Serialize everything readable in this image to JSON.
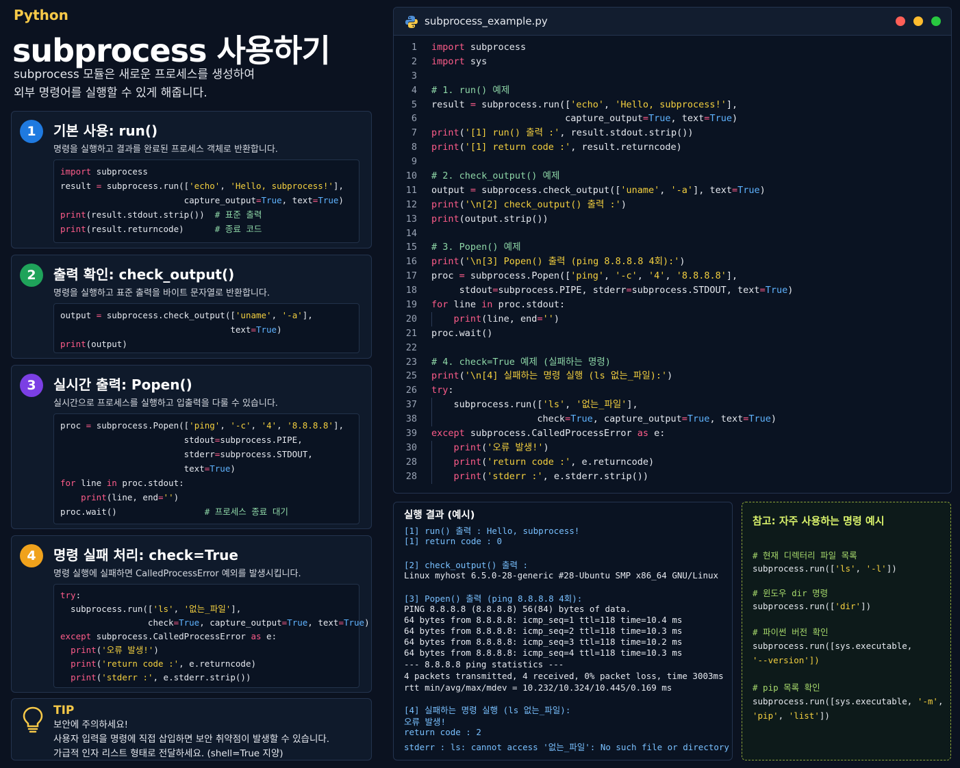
{
  "header": {
    "lang": "Python",
    "title": "subprocess 사용하기",
    "intro": [
      "subprocess 모듈은 새로운 프로세스를 생성하여",
      "외부 명령어를 실행할 수 있게 해줍니다."
    ]
  },
  "colors": {
    "accent": "#f7c948",
    "keyword": "#ff5c8a",
    "string": "#f4d03f",
    "builtin": "#5fb3ff",
    "comment": "#8fd8a8"
  },
  "cards": [
    {
      "num": "1",
      "title": "기본 사용: run()",
      "desc": "명령을 실행하고 결과를 완료된 프로세스 객체로 반환합니다."
    },
    {
      "num": "2",
      "title": "출력 확인: check_output()",
      "desc": "명령을 실행하고 표준 출력을 바이트 문자열로 반환합니다."
    },
    {
      "num": "3",
      "title": "실시간 출력: Popen()",
      "desc": "실시간으로 프로세스를 실행하고 입출력을 다룰 수 있습니다."
    },
    {
      "num": "4",
      "title": "명령 실패 처리: check=True",
      "desc": "명령 실행에 실패하면 CalledProcessError 예외를 발생시킵니다."
    }
  ],
  "tip": {
    "title": "TIP",
    "lines": [
      "보안에 주의하세요!",
      "사용자 입력을 명령에 직접 삽입하면 보안 취약점이 발생할 수 있습니다.",
      "가급적 인자 리스트 형태로 전달하세요. (shell=True 지양)"
    ]
  },
  "editor": {
    "filename": "subprocess_example.py",
    "line_numbers": [
      "1",
      "2",
      "3",
      "4",
      "5",
      "6",
      "7",
      "8",
      "9",
      "10",
      "11",
      "12",
      "13",
      "14",
      "15",
      "16",
      "17",
      "18",
      "19",
      "20",
      "21",
      "22",
      "23",
      "25",
      "26",
      "37",
      "38",
      "39",
      "30",
      "28",
      "28"
    ],
    "window_controls": [
      "close",
      "minimize",
      "maximize"
    ]
  },
  "output": {
    "title": "실행 결과 (예시)",
    "lines": [
      "[1] run() 출력 : Hello, subprocess!",
      "[1] return code : 0",
      "[2] check_output() 출력 :",
      "Linux myhost 6.5.0-28-generic #28-Ubuntu SMP x86_64 GNU/Linux",
      "[3] Popen() 출력 (ping 8.8.8.8 4회):",
      "PING 8.8.8.8 (8.8.8.8) 56(84) bytes of data.",
      "64 bytes from 8.8.8.8: icmp_seq=1 ttl=118 time=10.4 ms",
      "64 bytes from 8.8.8.8: icmp_seq=2 ttl=118 time=10.3 ms",
      "64 bytes from 8.8.8.8: icmp_seq=3 ttl=118 time=10.2 ms",
      "64 bytes from 8.8.8.8: icmp_seq=4 ttl=118 time=10.3 ms",
      "--- 8.8.8.8 ping statistics ---",
      "4 packets transmitted, 4 received, 0% packet loss, time 3003ms",
      "rtt min/avg/max/mdev = 10.232/10.324/10.445/0.169 ms",
      "[4] 실패하는 명령 실행 (ls 없는_파일):",
      "오류 발생!",
      "return code : 2",
      "stderr : ls: cannot access '없는_파일': No such file or directory"
    ]
  },
  "reference": {
    "title": "참고: 자주 사용하는 명령 예시",
    "lines": [
      "# 현재 디렉터리 파일 목록",
      "subprocess.run(['ls', '-l'])",
      "# 윈도우 dir 명령",
      "subprocess.run(['dir'])",
      "# 파이썬 버전 확인",
      "subprocess.run([sys.executable,",
      "'--version'])",
      "# pip 목록 확인",
      "subprocess.run([sys.executable, '-m',",
      "'pip', 'list'])"
    ]
  }
}
